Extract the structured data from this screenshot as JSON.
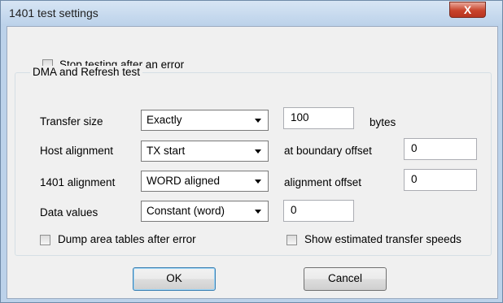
{
  "window": {
    "title": "1401 test settings",
    "close_symbol": "X"
  },
  "stop_on_error": {
    "label": "Stop testing after an error",
    "checked": false
  },
  "dma_group": {
    "caption": "DMA and Refresh test",
    "transfer_size": {
      "label": "Transfer size",
      "mode": "Exactly",
      "value": "100",
      "unit": "bytes"
    },
    "host_alignment": {
      "label": "Host alignment",
      "mode": "TX start",
      "offset_label": "at boundary offset",
      "offset_value": "0"
    },
    "alignment_1401": {
      "label": "1401 alignment",
      "mode": "WORD aligned",
      "offset_label": "alignment offset",
      "offset_value": "0"
    },
    "data_values": {
      "label": "Data values",
      "mode": "Constant (word)",
      "value": "0"
    },
    "dump_tables": {
      "label": "Dump area tables after error",
      "checked": false
    },
    "show_speeds": {
      "label": "Show estimated transfer speeds",
      "checked": false
    }
  },
  "buttons": {
    "ok": "OK",
    "cancel": "Cancel"
  }
}
